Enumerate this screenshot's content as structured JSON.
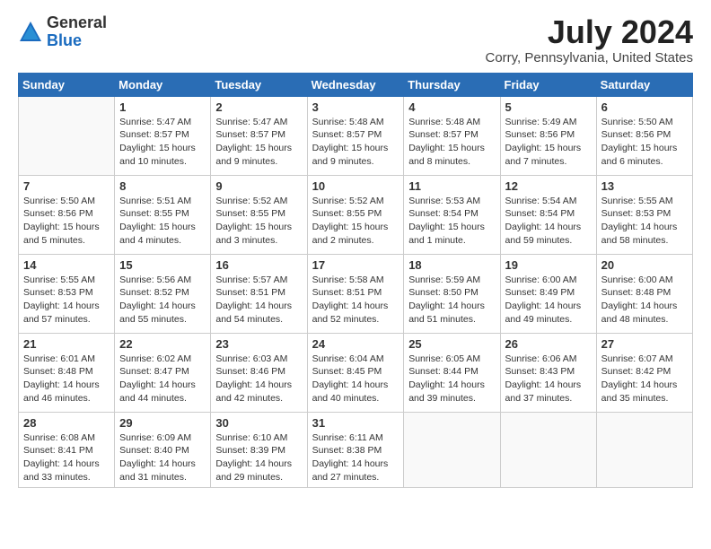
{
  "header": {
    "logo_general": "General",
    "logo_blue": "Blue",
    "month_title": "July 2024",
    "location": "Corry, Pennsylvania, United States"
  },
  "days_of_week": [
    "Sunday",
    "Monday",
    "Tuesday",
    "Wednesday",
    "Thursday",
    "Friday",
    "Saturday"
  ],
  "weeks": [
    [
      {
        "day": "",
        "info": ""
      },
      {
        "day": "1",
        "info": "Sunrise: 5:47 AM\nSunset: 8:57 PM\nDaylight: 15 hours\nand 10 minutes."
      },
      {
        "day": "2",
        "info": "Sunrise: 5:47 AM\nSunset: 8:57 PM\nDaylight: 15 hours\nand 9 minutes."
      },
      {
        "day": "3",
        "info": "Sunrise: 5:48 AM\nSunset: 8:57 PM\nDaylight: 15 hours\nand 9 minutes."
      },
      {
        "day": "4",
        "info": "Sunrise: 5:48 AM\nSunset: 8:57 PM\nDaylight: 15 hours\nand 8 minutes."
      },
      {
        "day": "5",
        "info": "Sunrise: 5:49 AM\nSunset: 8:56 PM\nDaylight: 15 hours\nand 7 minutes."
      },
      {
        "day": "6",
        "info": "Sunrise: 5:50 AM\nSunset: 8:56 PM\nDaylight: 15 hours\nand 6 minutes."
      }
    ],
    [
      {
        "day": "7",
        "info": "Sunrise: 5:50 AM\nSunset: 8:56 PM\nDaylight: 15 hours\nand 5 minutes."
      },
      {
        "day": "8",
        "info": "Sunrise: 5:51 AM\nSunset: 8:55 PM\nDaylight: 15 hours\nand 4 minutes."
      },
      {
        "day": "9",
        "info": "Sunrise: 5:52 AM\nSunset: 8:55 PM\nDaylight: 15 hours\nand 3 minutes."
      },
      {
        "day": "10",
        "info": "Sunrise: 5:52 AM\nSunset: 8:55 PM\nDaylight: 15 hours\nand 2 minutes."
      },
      {
        "day": "11",
        "info": "Sunrise: 5:53 AM\nSunset: 8:54 PM\nDaylight: 15 hours\nand 1 minute."
      },
      {
        "day": "12",
        "info": "Sunrise: 5:54 AM\nSunset: 8:54 PM\nDaylight: 14 hours\nand 59 minutes."
      },
      {
        "day": "13",
        "info": "Sunrise: 5:55 AM\nSunset: 8:53 PM\nDaylight: 14 hours\nand 58 minutes."
      }
    ],
    [
      {
        "day": "14",
        "info": "Sunrise: 5:55 AM\nSunset: 8:53 PM\nDaylight: 14 hours\nand 57 minutes."
      },
      {
        "day": "15",
        "info": "Sunrise: 5:56 AM\nSunset: 8:52 PM\nDaylight: 14 hours\nand 55 minutes."
      },
      {
        "day": "16",
        "info": "Sunrise: 5:57 AM\nSunset: 8:51 PM\nDaylight: 14 hours\nand 54 minutes."
      },
      {
        "day": "17",
        "info": "Sunrise: 5:58 AM\nSunset: 8:51 PM\nDaylight: 14 hours\nand 52 minutes."
      },
      {
        "day": "18",
        "info": "Sunrise: 5:59 AM\nSunset: 8:50 PM\nDaylight: 14 hours\nand 51 minutes."
      },
      {
        "day": "19",
        "info": "Sunrise: 6:00 AM\nSunset: 8:49 PM\nDaylight: 14 hours\nand 49 minutes."
      },
      {
        "day": "20",
        "info": "Sunrise: 6:00 AM\nSunset: 8:48 PM\nDaylight: 14 hours\nand 48 minutes."
      }
    ],
    [
      {
        "day": "21",
        "info": "Sunrise: 6:01 AM\nSunset: 8:48 PM\nDaylight: 14 hours\nand 46 minutes."
      },
      {
        "day": "22",
        "info": "Sunrise: 6:02 AM\nSunset: 8:47 PM\nDaylight: 14 hours\nand 44 minutes."
      },
      {
        "day": "23",
        "info": "Sunrise: 6:03 AM\nSunset: 8:46 PM\nDaylight: 14 hours\nand 42 minutes."
      },
      {
        "day": "24",
        "info": "Sunrise: 6:04 AM\nSunset: 8:45 PM\nDaylight: 14 hours\nand 40 minutes."
      },
      {
        "day": "25",
        "info": "Sunrise: 6:05 AM\nSunset: 8:44 PM\nDaylight: 14 hours\nand 39 minutes."
      },
      {
        "day": "26",
        "info": "Sunrise: 6:06 AM\nSunset: 8:43 PM\nDaylight: 14 hours\nand 37 minutes."
      },
      {
        "day": "27",
        "info": "Sunrise: 6:07 AM\nSunset: 8:42 PM\nDaylight: 14 hours\nand 35 minutes."
      }
    ],
    [
      {
        "day": "28",
        "info": "Sunrise: 6:08 AM\nSunset: 8:41 PM\nDaylight: 14 hours\nand 33 minutes."
      },
      {
        "day": "29",
        "info": "Sunrise: 6:09 AM\nSunset: 8:40 PM\nDaylight: 14 hours\nand 31 minutes."
      },
      {
        "day": "30",
        "info": "Sunrise: 6:10 AM\nSunset: 8:39 PM\nDaylight: 14 hours\nand 29 minutes."
      },
      {
        "day": "31",
        "info": "Sunrise: 6:11 AM\nSunset: 8:38 PM\nDaylight: 14 hours\nand 27 minutes."
      },
      {
        "day": "",
        "info": ""
      },
      {
        "day": "",
        "info": ""
      },
      {
        "day": "",
        "info": ""
      }
    ]
  ]
}
